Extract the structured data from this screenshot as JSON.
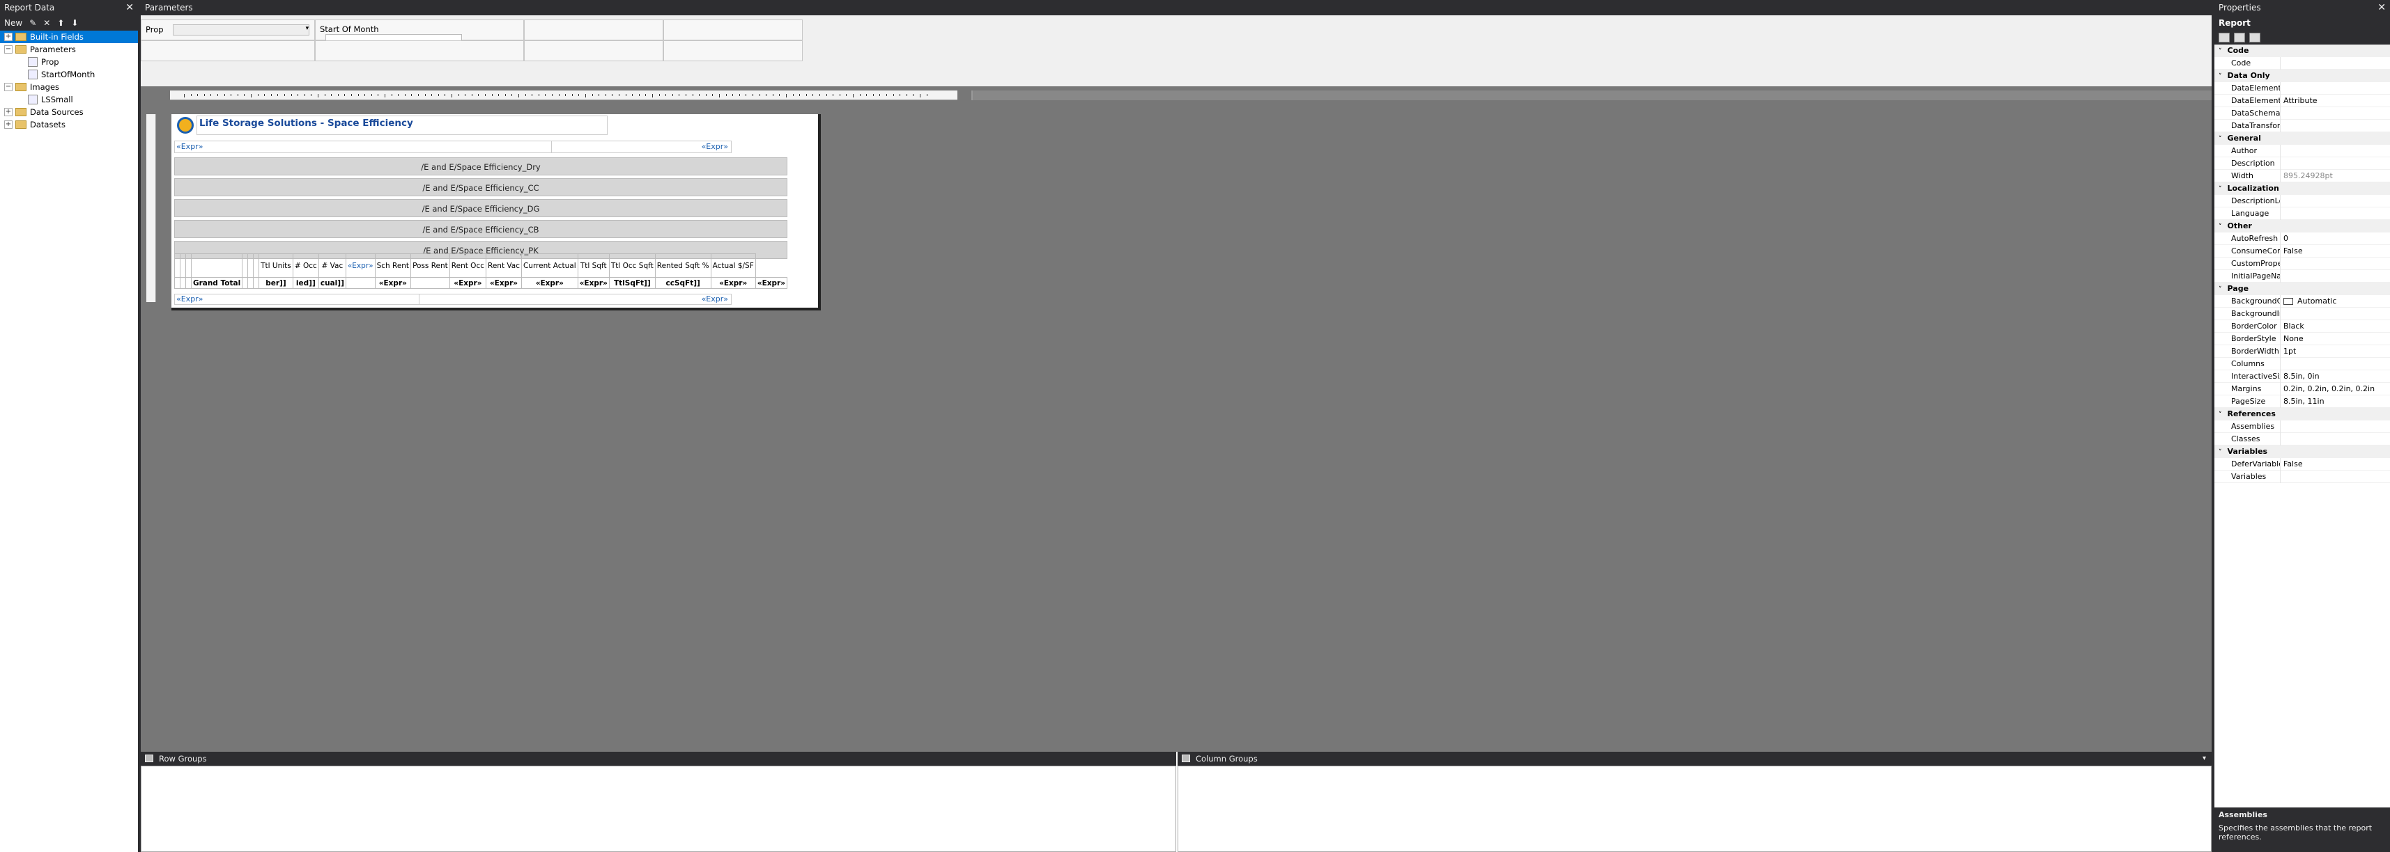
{
  "report_data": {
    "title": "Report Data",
    "toolbar_new": "New",
    "tree": [
      {
        "label": "Built-in Fields",
        "selected": true,
        "expander": "+"
      },
      {
        "label": "Parameters",
        "expander": "−"
      },
      {
        "label": "Prop",
        "child": true
      },
      {
        "label": "StartOfMonth",
        "child": true
      },
      {
        "label": "Images",
        "expander": "−"
      },
      {
        "label": "LSSmall",
        "child": true
      },
      {
        "label": "Data Sources",
        "expander": "+"
      },
      {
        "label": "Datasets",
        "expander": "+"
      }
    ]
  },
  "parameters": {
    "title": "Parameters",
    "prop_label": "Prop",
    "start_label": "Start Of Month"
  },
  "report": {
    "title": "Life Storage Solutions - Space Efficiency",
    "expr": "«Expr»",
    "subreports": [
      "/E and E/Space Efficiency_Dry",
      "/E and E/Space Efficiency_CC",
      "/E and E/Space Efficiency_DG",
      "/E and E/Space Efficiency_CB",
      "/E and E/Space Efficiency_PK"
    ],
    "headers": [
      "",
      "",
      "",
      "",
      "",
      "",
      "",
      "Ttl Units",
      "# Occ",
      "# Vac",
      "«Expr»",
      "Sch Rent",
      "Poss Rent",
      "Rent Occ",
      "Rent Vac",
      "Current Actual",
      "Ttl Sqft",
      "Ttl Occ Sqft",
      "Rented Sqft %",
      "Actual $/SF"
    ],
    "total_row": [
      "",
      "",
      "",
      "Grand Total",
      "",
      "",
      "",
      "ber]]",
      "ied]]",
      "cual]]",
      "",
      "«Expr»",
      "",
      "«Expr»",
      "«Expr»",
      "«Expr»",
      "«Expr»",
      "TtlSqFt]]",
      "ccSqFt]]",
      "«Expr»",
      "«Expr»"
    ]
  },
  "groups": {
    "row": "Row Groups",
    "column": "Column Groups"
  },
  "properties": {
    "title": "Properties",
    "object": "Report",
    "rows": [
      {
        "cat": "Code"
      },
      {
        "n": "Code",
        "v": ""
      },
      {
        "cat": "Data Only"
      },
      {
        "n": "DataElementNam",
        "v": ""
      },
      {
        "n": "DataElementStyle",
        "v": "Attribute"
      },
      {
        "n": "DataSchema",
        "v": ""
      },
      {
        "n": "DataTransform",
        "v": ""
      },
      {
        "cat": "General"
      },
      {
        "n": "Author",
        "v": ""
      },
      {
        "n": "Description",
        "v": ""
      },
      {
        "n": "Width",
        "v": "895.24928pt",
        "dim": true
      },
      {
        "cat": "Localization"
      },
      {
        "n": "DescriptionLocID",
        "v": ""
      },
      {
        "n": "Language",
        "v": ""
      },
      {
        "cat": "Other"
      },
      {
        "n": "AutoRefresh",
        "v": "0"
      },
      {
        "n": "ConsumeContain",
        "v": "False"
      },
      {
        "n": "CustomPropertie",
        "v": ""
      },
      {
        "n": "InitialPageName",
        "v": ""
      },
      {
        "cat": "Page"
      },
      {
        "n": "BackgroundColor",
        "v": "Automatic",
        "swatch": true
      },
      {
        "n": "BackgroundImag",
        "v": ""
      },
      {
        "n": "BorderColor",
        "v": "Black"
      },
      {
        "n": "BorderStyle",
        "v": "None"
      },
      {
        "n": "BorderWidth",
        "v": "1pt"
      },
      {
        "n": "Columns",
        "v": ""
      },
      {
        "n": "InteractiveSize",
        "v": "8.5in, 0in"
      },
      {
        "n": "Margins",
        "v": "0.2in, 0.2in, 0.2in, 0.2in"
      },
      {
        "n": "PageSize",
        "v": "8.5in, 11in"
      },
      {
        "cat": "References"
      },
      {
        "n": "Assemblies",
        "v": ""
      },
      {
        "n": "Classes",
        "v": ""
      },
      {
        "cat": "Variables"
      },
      {
        "n": "DeferVariableEval",
        "v": "False"
      },
      {
        "n": "Variables",
        "v": ""
      }
    ],
    "help_title": "Assemblies",
    "help_text": "Specifies the assemblies that the report references."
  }
}
